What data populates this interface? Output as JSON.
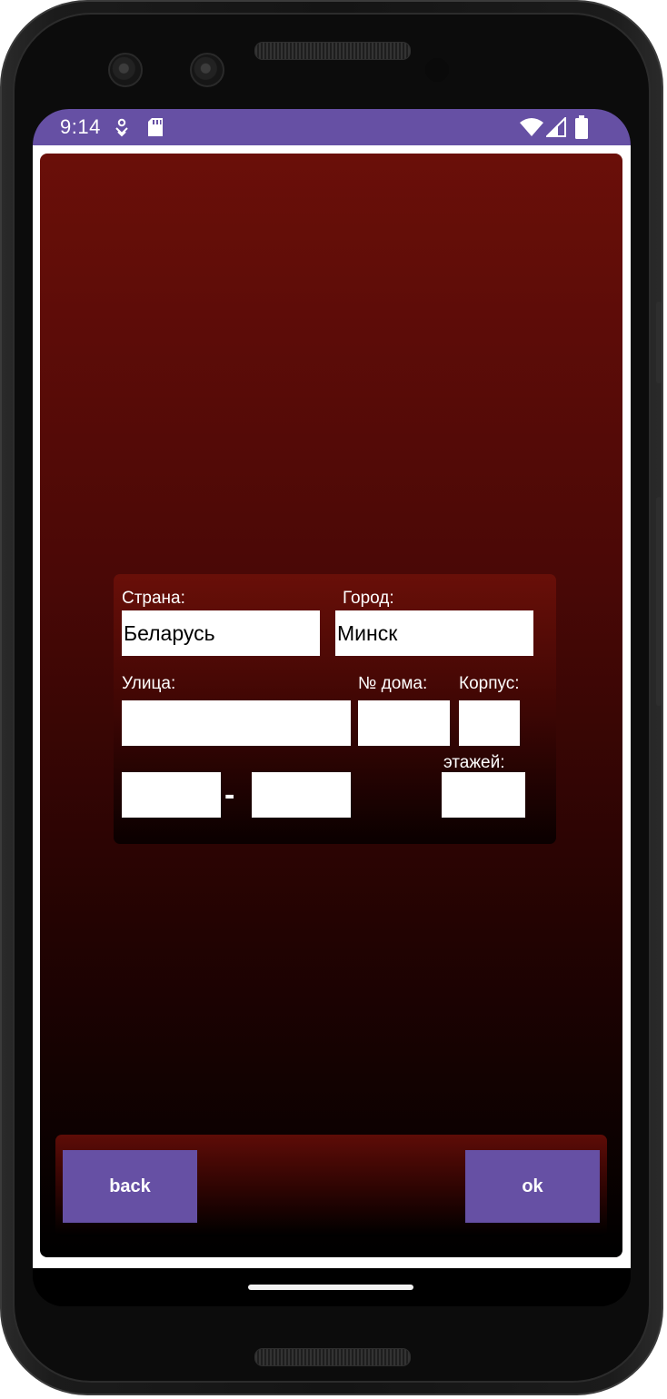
{
  "status_bar": {
    "time": "9:14",
    "icons": [
      "location-signal-icon",
      "sd-card-icon",
      "wifi-icon",
      "cell-signal-icon",
      "battery-icon"
    ],
    "color": "#6650a4"
  },
  "form": {
    "country": {
      "label": "Страна:",
      "value": "Беларусь"
    },
    "city": {
      "label": "Город:",
      "value": "Минск"
    },
    "street": {
      "label": "Улица:",
      "value": ""
    },
    "house": {
      "label": "№ дома:",
      "value": ""
    },
    "building": {
      "label": "Корпус:",
      "value": ""
    },
    "range_from": {
      "value": ""
    },
    "range_separator": "-",
    "range_to": {
      "value": ""
    },
    "floors": {
      "label": "этажей:",
      "value": ""
    }
  },
  "actions": {
    "back_label": "back",
    "ok_label": "ok",
    "button_color": "#6650a4"
  },
  "theme": {
    "panel_top": "#6a0f09",
    "panel_bottom": "#000000"
  }
}
